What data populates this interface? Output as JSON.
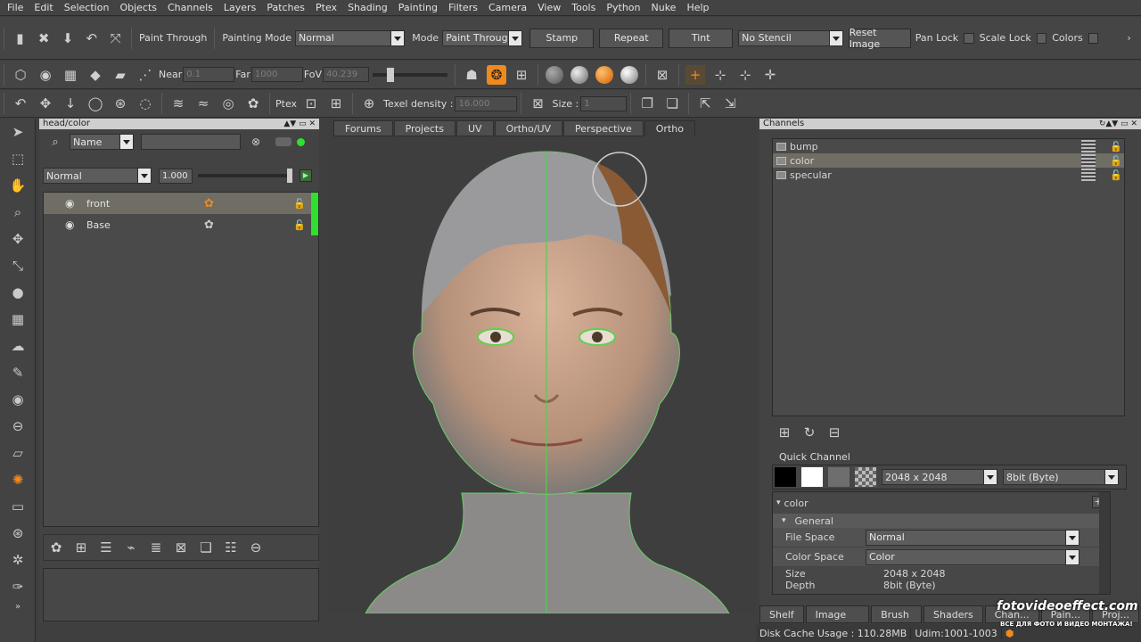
{
  "menu": [
    "File",
    "Edit",
    "Selection",
    "Objects",
    "Channels",
    "Layers",
    "Patches",
    "Ptex",
    "Shading",
    "Painting",
    "Filters",
    "Camera",
    "View",
    "Tools",
    "Python",
    "Nuke",
    "Help"
  ],
  "toolbar1": {
    "paint_through": "Paint Through",
    "painting_mode_label": "Painting Mode",
    "painting_mode_value": "Normal",
    "mode_label": "Mode",
    "mode_value": "Paint Through",
    "stamp": "Stamp",
    "repeat": "Repeat",
    "tint": "Tint",
    "stencil_value": "No Stencil",
    "reset_image": "Reset Image",
    "pan_lock": "Pan Lock",
    "scale_lock": "Scale Lock",
    "colors": "Colors"
  },
  "toolbar2": {
    "near_label": "Near",
    "near_value": "0.1",
    "far_label": "Far",
    "far_value": "1000",
    "fov_label": "FoV",
    "fov_value": "40.239"
  },
  "toolbar3": {
    "ptex_label": "Ptex",
    "texel_label": "Texel density :",
    "texel_value": "16.000",
    "size_label": "Size :",
    "size_value": "1"
  },
  "layers_panel": {
    "title": "head/color",
    "filter_value": "Name",
    "blend_value": "Normal",
    "opacity_value": "1.000",
    "layers": [
      {
        "name": "front",
        "selected": true
      },
      {
        "name": "Base",
        "selected": false
      }
    ]
  },
  "viewport_tabs": [
    "Forums",
    "Projects",
    "UV",
    "Ortho/UV",
    "Perspective",
    "Ortho"
  ],
  "active_tab": "Ortho",
  "channels_panel": {
    "title": "Channels",
    "items": [
      {
        "name": "bump",
        "selected": false
      },
      {
        "name": "color",
        "selected": true
      },
      {
        "name": "specular",
        "selected": false
      }
    ],
    "quick_channel_label": "Quick Channel",
    "quick_size": "2048 x 2048",
    "quick_depth": "8bit  (Byte)",
    "prop_header": "color",
    "prop_group": "General",
    "file_space_label": "File Space",
    "file_space_value": "Normal",
    "color_space_label": "Color Space",
    "color_space_value": "Color",
    "size_label": "Size",
    "size_value": "2048 x 2048",
    "depth_label": "Depth",
    "depth_value": "8bit  (Byte)"
  },
  "bottom_tabs": [
    "Shelf",
    "Image Ma...",
    "Brush ...",
    "Shaders",
    "Chan...",
    "Pain...",
    "Proj..."
  ],
  "status": {
    "disk_cache": "Disk Cache Usage : 110.28MB",
    "udim": "Udim:1001-1003"
  },
  "watermark": "fotovideoeffect.com",
  "watermark_sub": "ВСЕ ДЛЯ ФОТО И ВИДЕО МОНТАЖА!",
  "colors": {
    "accent": "#f08a1c",
    "layer_active": "#2fe02f",
    "selection": "#6f6d64"
  }
}
